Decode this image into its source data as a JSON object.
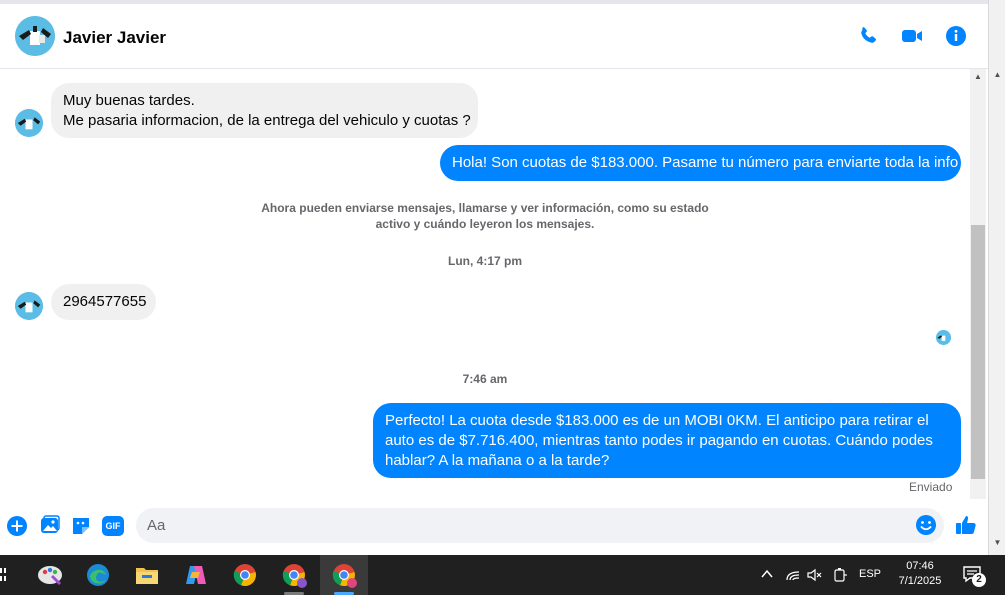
{
  "header": {
    "contact_name": "Javier Javier",
    "call_icon": "phone-icon",
    "video_icon": "video-camera-icon",
    "info_icon": "info-icon"
  },
  "messages": {
    "m1_line1": "Muy buenas tardes.",
    "m1_line2": "Me pasaria informacion, de la entrega del vehiculo y cuotas ?",
    "m2": "Hola! Son cuotas de $183.000. Pasame tu número para enviarte toda la info",
    "system_line1": "Ahora pueden enviarse mensajes, llamarse y ver información, como su estado",
    "system_line2": "activo y cuándo leyeron los mensajes.",
    "ts1": "Lun, 4:17 pm",
    "m3": "2964577655",
    "ts2": "7:46 am",
    "m4_line1": "Perfecto! La cuota desde $183.000 es de un MOBI 0KM. El anticipo para retirar el",
    "m4_line2": "auto es de $7.716.400, mientras tanto podes ir pagando en cuotas. Cuándo podes",
    "m4_line3": "hablar? A la mañana o a la tarde?",
    "status": "Enviado"
  },
  "composer": {
    "placeholder": "Aa",
    "add_icon": "plus-circle-icon",
    "image_icon": "image-icon",
    "sticker_icon": "sticker-icon",
    "gif_label": "GIF",
    "emoji_icon": "emoji-icon",
    "like_icon": "thumbs-up-icon"
  },
  "taskbar": {
    "language": "ESP",
    "time": "07:46",
    "date": "7/1/2025",
    "notification_count": "2"
  },
  "colors": {
    "accent": "#0084ff",
    "incoming_bubble": "#f0f0f0",
    "avatar": "#5bbde6",
    "taskbar": "#202020"
  }
}
